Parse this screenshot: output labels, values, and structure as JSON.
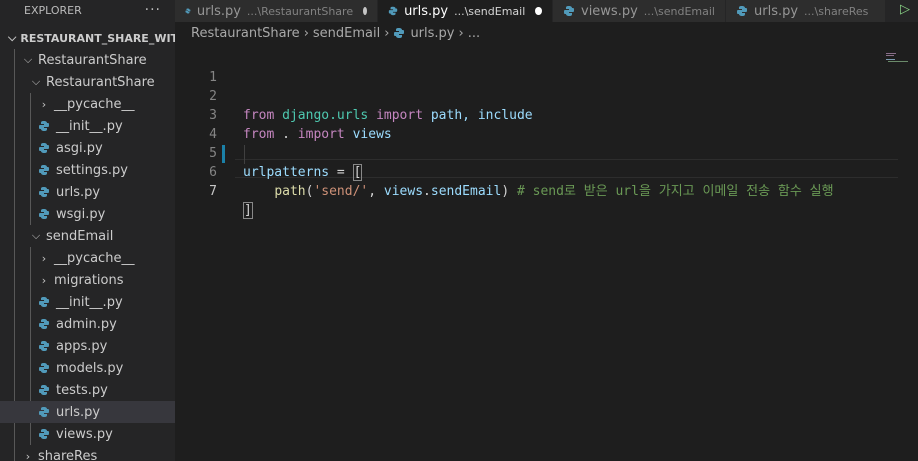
{
  "explorer": {
    "title": "EXPLORER",
    "more_label": "···",
    "root": "RESTAURANT_SHARE_WIT...",
    "items": [
      {
        "label": "RestaurantShare"
      },
      {
        "label": "RestaurantShare"
      },
      {
        "label": "__pycache__"
      },
      {
        "label": "__init__.py"
      },
      {
        "label": "asgi.py"
      },
      {
        "label": "settings.py"
      },
      {
        "label": "urls.py"
      },
      {
        "label": "wsgi.py"
      },
      {
        "label": "sendEmail"
      },
      {
        "label": "__pycache__"
      },
      {
        "label": "migrations"
      },
      {
        "label": "__init__.py"
      },
      {
        "label": "admin.py"
      },
      {
        "label": "apps.py"
      },
      {
        "label": "models.py"
      },
      {
        "label": "tests.py"
      },
      {
        "label": "urls.py"
      },
      {
        "label": "views.py"
      },
      {
        "label": "shareRes"
      }
    ]
  },
  "tabs": [
    {
      "name": "urls.py",
      "desc": "...\\RestaurantShare"
    },
    {
      "name": "urls.py",
      "desc": "...\\sendEmail"
    },
    {
      "name": "views.py",
      "desc": "...\\sendEmail"
    },
    {
      "name": "urls.py",
      "desc": "...\\shareRes"
    }
  ],
  "breadcrumb": {
    "parts": [
      "RestaurantShare",
      "sendEmail",
      "urls.py",
      "..."
    ]
  },
  "editor": {
    "line_numbers": [
      "1",
      "2",
      "3",
      "4",
      "5",
      "6",
      "7"
    ],
    "line2": {
      "kw1": "from",
      "mod": "django.urls",
      "kw2": "import",
      "rest": "path, include"
    },
    "line3": {
      "kw1": "from",
      "dot": ".",
      "kw2": "import",
      "name": "views"
    },
    "line5": {
      "name": "urlpatterns",
      "op": " = ",
      "bracket": "["
    },
    "line6": {
      "fn": "path",
      "open": "(",
      "str": "'send/'",
      "comma": ", ",
      "obj": "views",
      "dot": ".",
      "attr": "sendEmail",
      "close": ")",
      "comment": "# send로 받은 url을 가지고 이메일 전송 함수 실행"
    },
    "line7": {
      "bracket": "]"
    }
  },
  "colors": {
    "python_icon": "#519aba",
    "modified_dot": "#c5c5c5",
    "active_dot": "#ffffff",
    "run": "#89d185"
  }
}
